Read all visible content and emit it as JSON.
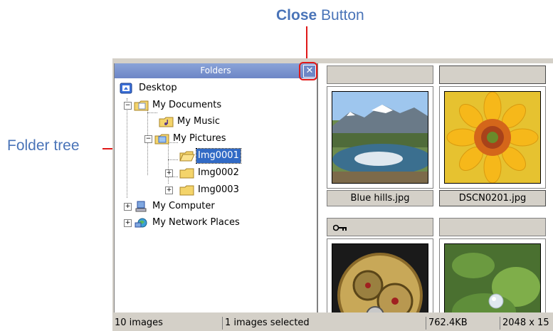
{
  "callouts": {
    "close_bold": "Close",
    "close_rest": " Button",
    "tree": "Folder tree"
  },
  "folders": {
    "title": "Folders",
    "close_glyph": "✕",
    "nodes": [
      {
        "label": "Desktop",
        "icon": "desktop-icon"
      },
      {
        "label": "My Documents",
        "icon": "my-documents-icon",
        "expander": "−"
      },
      {
        "label": "My Music",
        "icon": "music-folder-icon"
      },
      {
        "label": "My Pictures",
        "icon": "pictures-folder-icon",
        "expander": "−"
      },
      {
        "label": "Img0001",
        "icon": "open-folder-icon",
        "selected": true
      },
      {
        "label": "Img0002",
        "icon": "folder-icon",
        "expander": "+"
      },
      {
        "label": "Img0003",
        "icon": "folder-icon",
        "expander": "+"
      },
      {
        "label": "My Computer",
        "icon": "computer-icon",
        "expander": "+"
      },
      {
        "label": "My Network Places",
        "icon": "network-places-icon",
        "expander": "+"
      }
    ]
  },
  "thumbnails": [
    {
      "name": "Blue hills.jpg",
      "image": "mountain-lake-image"
    },
    {
      "name": "DSCN0201.jpg",
      "image": "sunflower-image",
      "selected": true
    },
    {
      "name": "",
      "image": "pocket-watch-image",
      "badge": "key-icon"
    },
    {
      "name": "",
      "image": "water-drop-leaf-image"
    }
  ],
  "status": {
    "count": "10 images",
    "selected": "1 images selected",
    "size": "762.4KB",
    "dimensions": "2048 x 15"
  },
  "colors": {
    "accent": "#4a74b8",
    "highlight": "#e01818",
    "selection": "#316ac5"
  }
}
